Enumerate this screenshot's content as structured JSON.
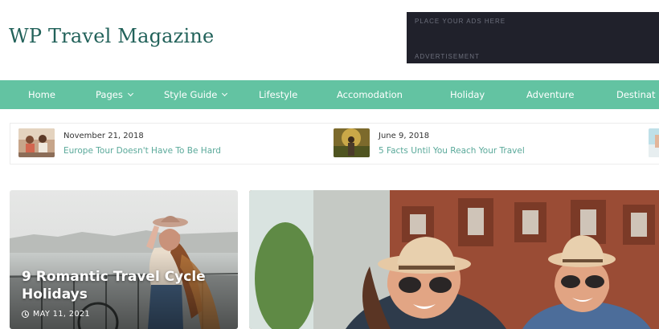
{
  "site": {
    "title": "WP Travel Magazine"
  },
  "ad": {
    "top_text": "PLACE YOUR ADS HERE",
    "bottom_text": "ADVERTISEMENT"
  },
  "nav": {
    "items": [
      {
        "label": "Home",
        "has_dropdown": false
      },
      {
        "label": "Pages",
        "has_dropdown": true
      },
      {
        "label": "Style Guide",
        "has_dropdown": true
      },
      {
        "label": "Lifestyle",
        "has_dropdown": false
      },
      {
        "label": "Accomodation",
        "has_dropdown": false
      },
      {
        "label": "Holiday",
        "has_dropdown": false
      },
      {
        "label": "Adventure",
        "has_dropdown": false
      },
      {
        "label": "Destinat",
        "has_dropdown": false
      }
    ]
  },
  "ticker": {
    "items": [
      {
        "date": "November 21, 2018",
        "title": "Europe Tour Doesn't Have To Be Hard"
      },
      {
        "date": "June 9, 2018",
        "title": "5 Facts Until You Reach Your Travel"
      }
    ]
  },
  "featured": {
    "left": {
      "title": "9 Romantic Travel Cycle Holidays",
      "date": "MAY 11, 2021"
    }
  },
  "colors": {
    "accent": "#63c3a2",
    "title": "#22625a",
    "ad_bg": "#20212b",
    "link": "#5aa99a"
  }
}
